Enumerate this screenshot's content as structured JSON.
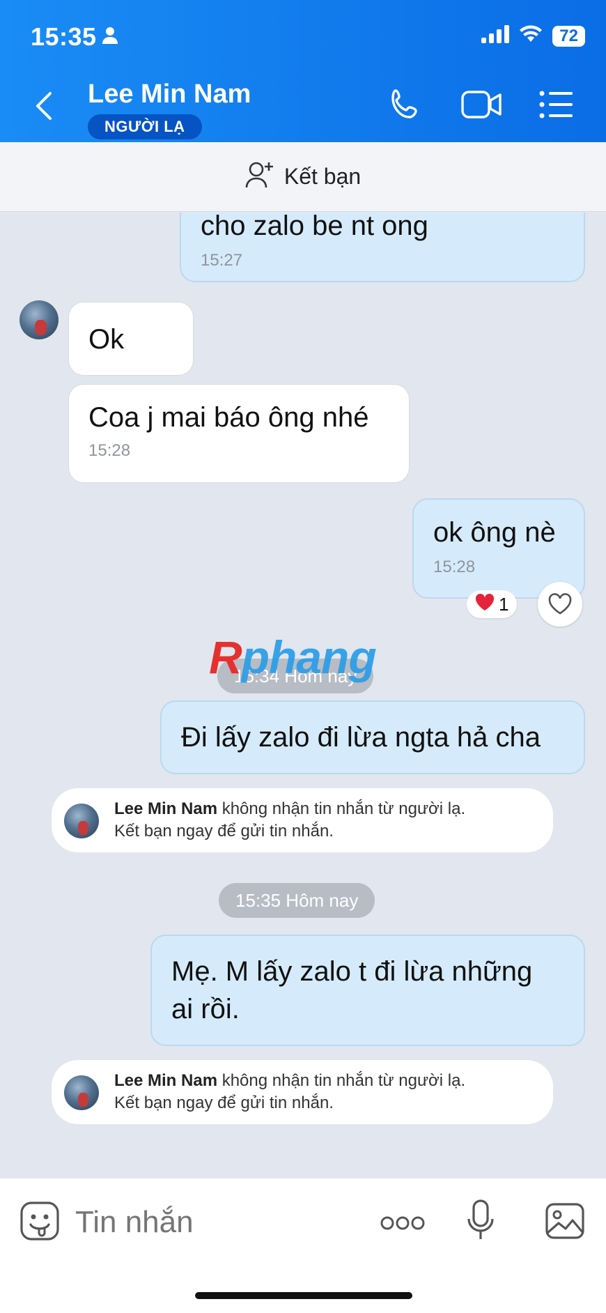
{
  "status": {
    "time": "15:35",
    "battery": "72"
  },
  "header": {
    "contact_name": "Lee Min Nam",
    "badge": "NGƯỜI LẠ"
  },
  "add_friend": {
    "label": "Kết bạn"
  },
  "messages": [
    {
      "side": "me",
      "text": "cho zalo be nt ong",
      "time": "15:27"
    },
    {
      "side": "them",
      "text": "Ok",
      "time": ""
    },
    {
      "side": "them",
      "text": "Coa j mai báo ông nhé",
      "time": "15:28"
    },
    {
      "side": "me",
      "text": "ok ông nè",
      "time": "15:28",
      "reaction": {
        "emoji": "❤️",
        "count": "1"
      }
    },
    {
      "side": "me",
      "text": "Đi lấy zalo đi lừa ngta hả cha",
      "time": ""
    },
    {
      "side": "me",
      "text_line1": "Mẹ. M lấy zalo t đi lừa những",
      "text_line2": "ai rồi.",
      "time": ""
    }
  ],
  "date_separators": [
    "15:34 Hôm nay",
    "15:35 Hôm nay"
  ],
  "system_notes": [
    {
      "name": "Lee Min Nam",
      "line1": " không nhận tin nhắn từ người lạ.",
      "line2": "Kết bạn ngay để gửi tin nhắn."
    },
    {
      "name": "Lee Min Nam",
      "line1": " không nhận tin nhắn từ người lạ.",
      "line2": "Kết bạn ngay để gửi tin nhắn."
    }
  ],
  "watermark": {
    "first": "R",
    "rest": "phang"
  },
  "composer": {
    "placeholder": "Tin nhắn"
  },
  "colors": {
    "header": "#0a6de6",
    "my_bubble": "#d5ebfb",
    "chat_bg": "#e2e6ee"
  }
}
